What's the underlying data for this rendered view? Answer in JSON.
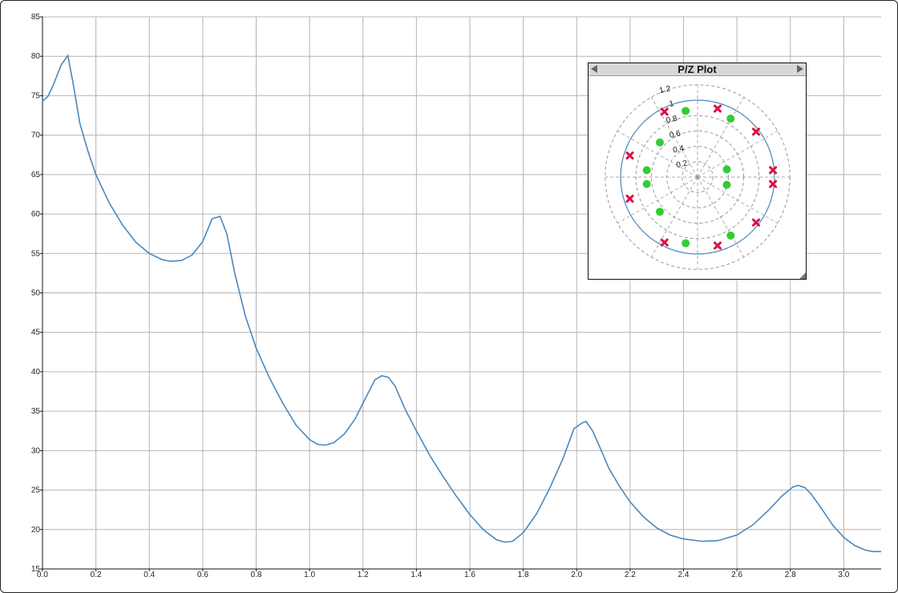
{
  "chart_data": [
    {
      "type": "line",
      "title": "",
      "xlabel": "",
      "ylabel": "",
      "xlim": [
        0,
        3.14
      ],
      "ylim": [
        15,
        85
      ],
      "grid": true,
      "x_ticks": [
        0.0,
        0.2,
        0.4,
        0.6,
        0.8,
        1.0,
        1.2,
        1.4,
        1.6,
        1.8,
        2.0,
        2.2,
        2.4,
        2.6,
        2.8,
        3.0
      ],
      "x_tick_labels": [
        "0.0",
        "0.2",
        "0.4",
        "0.6",
        "0.8",
        "1.0",
        "1.2",
        "1.4",
        "1.6",
        "1.8",
        "2.0",
        "2.2",
        "2.4",
        "2.6",
        "2.8",
        "3.0"
      ],
      "y_ticks": [
        15,
        20,
        25,
        30,
        35,
        40,
        45,
        50,
        55,
        60,
        65,
        70,
        75,
        80,
        85
      ],
      "y_tick_labels": [
        "15",
        "20",
        "25",
        "30",
        "35",
        "40",
        "45",
        "50",
        "55",
        "60",
        "65",
        "70",
        "75",
        "80",
        "85"
      ],
      "series": [
        {
          "color": "#4a88be",
          "x": [
            0.0,
            0.02,
            0.04,
            0.07,
            0.095,
            0.115,
            0.14,
            0.17,
            0.2,
            0.25,
            0.3,
            0.35,
            0.4,
            0.45,
            0.48,
            0.52,
            0.56,
            0.6,
            0.635,
            0.665,
            0.69,
            0.72,
            0.76,
            0.8,
            0.85,
            0.9,
            0.95,
            1.0,
            1.03,
            1.06,
            1.09,
            1.13,
            1.17,
            1.21,
            1.245,
            1.27,
            1.295,
            1.32,
            1.36,
            1.4,
            1.45,
            1.5,
            1.55,
            1.6,
            1.65,
            1.7,
            1.73,
            1.76,
            1.8,
            1.85,
            1.9,
            1.95,
            1.99,
            2.02,
            2.035,
            2.06,
            2.09,
            2.12,
            2.16,
            2.2,
            2.25,
            2.3,
            2.35,
            2.4,
            2.47,
            2.53,
            2.6,
            2.66,
            2.72,
            2.77,
            2.81,
            2.83,
            2.855,
            2.88,
            2.92,
            2.96,
            3.0,
            3.04,
            3.08,
            3.11,
            3.14
          ],
          "y": [
            74.3,
            74.9,
            76.3,
            78.9,
            80.1,
            76.5,
            71.5,
            68.0,
            65.0,
            61.4,
            58.6,
            56.4,
            55.0,
            54.2,
            54.0,
            54.1,
            54.8,
            56.5,
            59.4,
            59.7,
            57.5,
            52.5,
            47.0,
            43.0,
            39.2,
            36.0,
            33.2,
            31.4,
            30.8,
            30.7,
            31.0,
            32.1,
            34.0,
            36.7,
            39.0,
            39.5,
            39.3,
            38.2,
            35.1,
            32.5,
            29.4,
            26.7,
            24.2,
            21.9,
            20.0,
            18.7,
            18.4,
            18.5,
            19.6,
            22.0,
            25.3,
            29.1,
            32.8,
            33.5,
            33.7,
            32.5,
            30.2,
            27.8,
            25.5,
            23.5,
            21.6,
            20.2,
            19.3,
            18.8,
            18.5,
            18.6,
            19.3,
            20.6,
            22.5,
            24.3,
            25.4,
            25.6,
            25.3,
            24.4,
            22.5,
            20.5,
            19.0,
            18.0,
            17.4,
            17.2,
            17.2
          ]
        }
      ]
    },
    {
      "type": "scatter",
      "title": "P/Z Plot",
      "radial_ticks": [
        "0.2",
        "0.4",
        "0.6",
        "0.8",
        "1",
        "1.2"
      ],
      "rlim": [
        0,
        1.2
      ],
      "unit_circle": true,
      "zeros_color": "#33cc33",
      "poles_color": "#dd1144",
      "zeros": [
        {
          "re": -0.155,
          "im": 0.86
        },
        {
          "re": 0.43,
          "im": 0.76
        },
        {
          "re": -0.49,
          "im": 0.45
        },
        {
          "re": -0.66,
          "im": 0.09
        },
        {
          "re": 0.38,
          "im": 0.1
        },
        {
          "re": -0.66,
          "im": -0.09
        },
        {
          "re": 0.38,
          "im": -0.1
        },
        {
          "re": -0.49,
          "im": -0.45
        },
        {
          "re": -0.155,
          "im": -0.86
        },
        {
          "re": 0.43,
          "im": -0.76
        }
      ],
      "poles": [
        {
          "re": -0.43,
          "im": 0.85
        },
        {
          "re": 0.26,
          "im": 0.89
        },
        {
          "re": 0.76,
          "im": 0.59
        },
        {
          "re": -0.88,
          "im": 0.28
        },
        {
          "re": 0.98,
          "im": 0.09
        },
        {
          "re": 0.98,
          "im": -0.09
        },
        {
          "re": -0.88,
          "im": -0.28
        },
        {
          "re": 0.76,
          "im": -0.59
        },
        {
          "re": -0.43,
          "im": -0.85
        },
        {
          "re": 0.26,
          "im": -0.89
        }
      ]
    }
  ],
  "pz_window": {
    "title": "P/Z Plot",
    "left_arrow": "◀",
    "right_arrow": "▶"
  }
}
